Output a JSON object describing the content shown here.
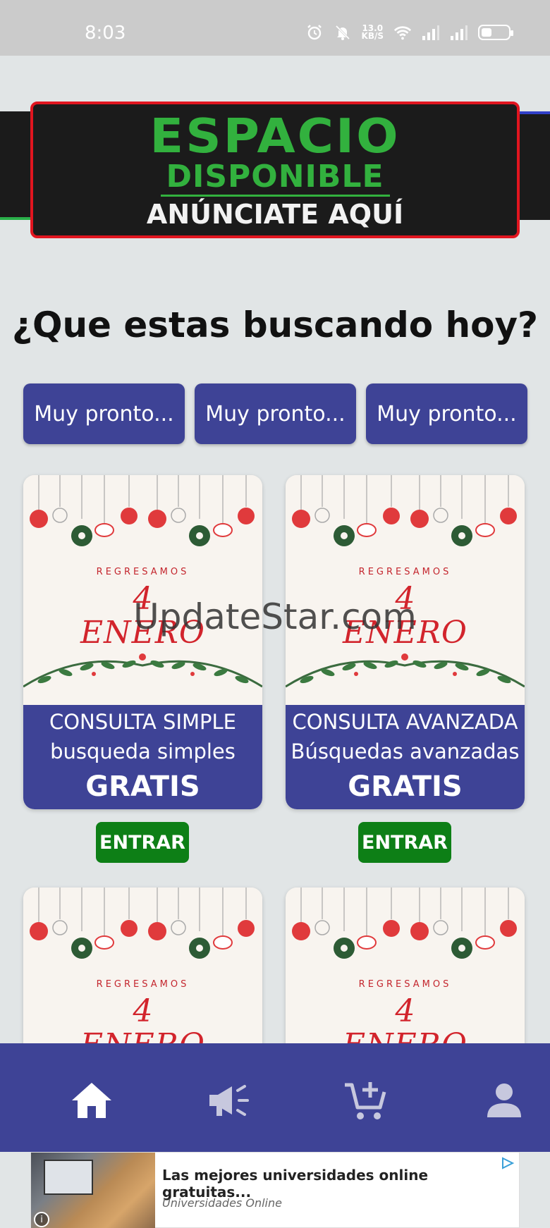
{
  "status_bar": {
    "time": "8:03",
    "speed_value": "13.0",
    "speed_unit": "KB/S",
    "icons": [
      "alarm-icon",
      "bell-off-icon",
      "wifi-icon",
      "signal-icon",
      "signal-icon",
      "battery-icon"
    ]
  },
  "banner": {
    "line1": "ESPACIO",
    "line2": "DISPONIBLE",
    "line3": "ANÚNCIATE AQUÍ"
  },
  "heading": "¿Que estas buscando hoy?",
  "quick_buttons": [
    {
      "label": "Muy pronto..."
    },
    {
      "label": "Muy pronto..."
    },
    {
      "label": "Muy pronto..."
    }
  ],
  "cards": [
    {
      "art": {
        "regresamos": "REGRESAMOS",
        "day": "4",
        "month": "ENERO"
      },
      "title": "CONSULTA SIMPLE",
      "subtitle": "busqueda simples",
      "price": "GRATIS",
      "button": "ENTRAR"
    },
    {
      "art": {
        "regresamos": "REGRESAMOS",
        "day": "4",
        "month": "ENERO"
      },
      "title": "CONSULTA AVANZADA",
      "subtitle": "Búsquedas avanzadas",
      "price": "GRATIS",
      "button": "ENTRAR"
    },
    {
      "art": {
        "regresamos": "REGRESAMOS",
        "day": "4",
        "month": "ENERO"
      }
    },
    {
      "art": {
        "regresamos": "REGRESAMOS",
        "day": "4",
        "month": "ENERO"
      }
    }
  ],
  "watermark": "UpdateStar.com",
  "bottom_nav": [
    "home-icon",
    "megaphone-icon",
    "cart-add-icon",
    "user-icon"
  ],
  "ad": {
    "title": "Las mejores universidades online gratuitas...",
    "subtitle": "Universidades Online",
    "info": "i"
  },
  "colors": {
    "primary": "#3e4396",
    "success": "#0d7f16",
    "banner_green": "#32b13e",
    "banner_red": "#e1151f",
    "festive_red": "#d2242c",
    "background": "#e1e5e6"
  }
}
